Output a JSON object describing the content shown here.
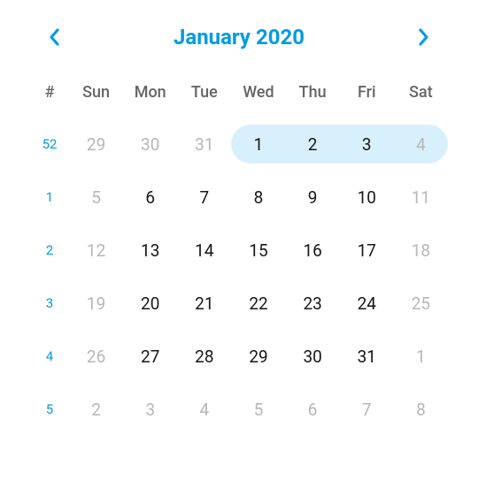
{
  "header": {
    "title": "January 2020",
    "hash": "#"
  },
  "weekdays": [
    "Sun",
    "Mon",
    "Tue",
    "Wed",
    "Thu",
    "Fri",
    "Sat"
  ],
  "rows": [
    {
      "week": "52",
      "days": [
        {
          "n": "29",
          "outside": true,
          "sel": false,
          "start": false,
          "end": false
        },
        {
          "n": "30",
          "outside": true,
          "sel": false,
          "start": false,
          "end": false
        },
        {
          "n": "31",
          "outside": true,
          "sel": false,
          "start": false,
          "end": false
        },
        {
          "n": "1",
          "outside": false,
          "sel": true,
          "start": true,
          "end": false
        },
        {
          "n": "2",
          "outside": false,
          "sel": true,
          "start": false,
          "end": false
        },
        {
          "n": "3",
          "outside": false,
          "sel": true,
          "start": false,
          "end": false
        },
        {
          "n": "4",
          "outside": true,
          "sel": true,
          "start": false,
          "end": true
        }
      ]
    },
    {
      "week": "1",
      "days": [
        {
          "n": "5",
          "outside": true,
          "sel": false,
          "start": false,
          "end": false
        },
        {
          "n": "6",
          "outside": false,
          "sel": false,
          "start": false,
          "end": false
        },
        {
          "n": "7",
          "outside": false,
          "sel": false,
          "start": false,
          "end": false
        },
        {
          "n": "8",
          "outside": false,
          "sel": false,
          "start": false,
          "end": false
        },
        {
          "n": "9",
          "outside": false,
          "sel": false,
          "start": false,
          "end": false
        },
        {
          "n": "10",
          "outside": false,
          "sel": false,
          "start": false,
          "end": false
        },
        {
          "n": "11",
          "outside": true,
          "sel": false,
          "start": false,
          "end": false
        }
      ]
    },
    {
      "week": "2",
      "days": [
        {
          "n": "12",
          "outside": true,
          "sel": false,
          "start": false,
          "end": false
        },
        {
          "n": "13",
          "outside": false,
          "sel": false,
          "start": false,
          "end": false
        },
        {
          "n": "14",
          "outside": false,
          "sel": false,
          "start": false,
          "end": false
        },
        {
          "n": "15",
          "outside": false,
          "sel": false,
          "start": false,
          "end": false
        },
        {
          "n": "16",
          "outside": false,
          "sel": false,
          "start": false,
          "end": false
        },
        {
          "n": "17",
          "outside": false,
          "sel": false,
          "start": false,
          "end": false
        },
        {
          "n": "18",
          "outside": true,
          "sel": false,
          "start": false,
          "end": false
        }
      ]
    },
    {
      "week": "3",
      "days": [
        {
          "n": "19",
          "outside": true,
          "sel": false,
          "start": false,
          "end": false
        },
        {
          "n": "20",
          "outside": false,
          "sel": false,
          "start": false,
          "end": false
        },
        {
          "n": "21",
          "outside": false,
          "sel": false,
          "start": false,
          "end": false
        },
        {
          "n": "22",
          "outside": false,
          "sel": false,
          "start": false,
          "end": false
        },
        {
          "n": "23",
          "outside": false,
          "sel": false,
          "start": false,
          "end": false
        },
        {
          "n": "24",
          "outside": false,
          "sel": false,
          "start": false,
          "end": false
        },
        {
          "n": "25",
          "outside": true,
          "sel": false,
          "start": false,
          "end": false
        }
      ]
    },
    {
      "week": "4",
      "days": [
        {
          "n": "26",
          "outside": true,
          "sel": false,
          "start": false,
          "end": false
        },
        {
          "n": "27",
          "outside": false,
          "sel": false,
          "start": false,
          "end": false
        },
        {
          "n": "28",
          "outside": false,
          "sel": false,
          "start": false,
          "end": false
        },
        {
          "n": "29",
          "outside": false,
          "sel": false,
          "start": false,
          "end": false
        },
        {
          "n": "30",
          "outside": false,
          "sel": false,
          "start": false,
          "end": false
        },
        {
          "n": "31",
          "outside": false,
          "sel": false,
          "start": false,
          "end": false
        },
        {
          "n": "1",
          "outside": true,
          "sel": false,
          "start": false,
          "end": false
        }
      ]
    },
    {
      "week": "5",
      "days": [
        {
          "n": "2",
          "outside": true,
          "sel": false,
          "start": false,
          "end": false
        },
        {
          "n": "3",
          "outside": true,
          "sel": false,
          "start": false,
          "end": false
        },
        {
          "n": "4",
          "outside": true,
          "sel": false,
          "start": false,
          "end": false
        },
        {
          "n": "5",
          "outside": true,
          "sel": false,
          "start": false,
          "end": false
        },
        {
          "n": "6",
          "outside": true,
          "sel": false,
          "start": false,
          "end": false
        },
        {
          "n": "7",
          "outside": true,
          "sel": false,
          "start": false,
          "end": false
        },
        {
          "n": "8",
          "outside": true,
          "sel": false,
          "start": false,
          "end": false
        }
      ]
    }
  ]
}
